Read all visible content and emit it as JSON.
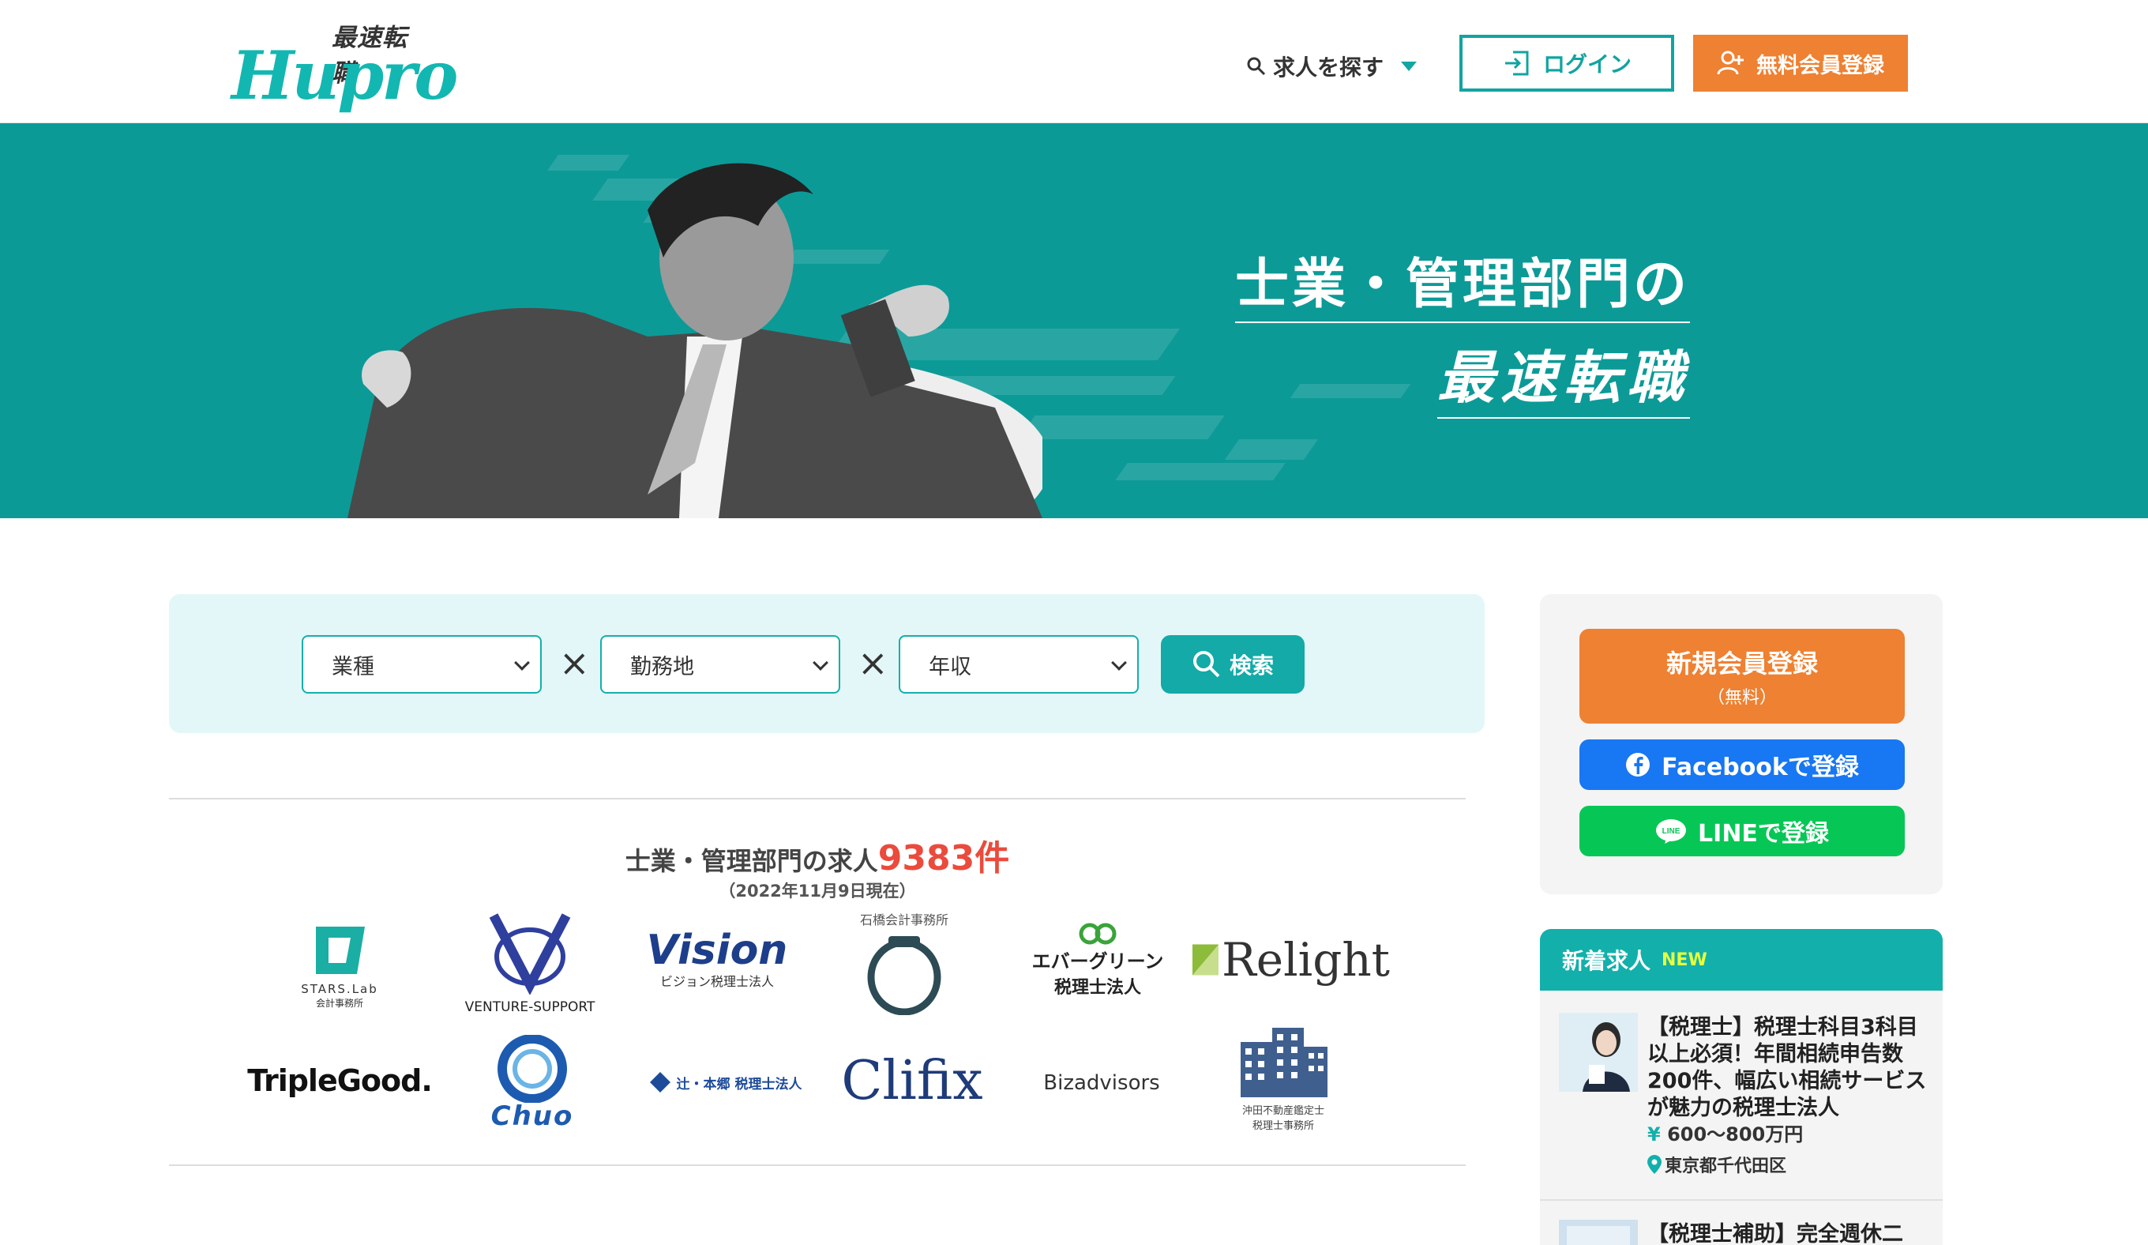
{
  "header": {
    "logo_tagline": "最速転職",
    "logo_word": "Hupro",
    "nav_search_label": "求人を探す",
    "login_label": "ログイン",
    "register_label": "無料会員登録"
  },
  "hero": {
    "line1": "士業・管理部門の",
    "line2": "最速転職"
  },
  "search": {
    "industry_select": "業種",
    "location_select": "勤務地",
    "salary_select": "年収",
    "times_symbol": "×",
    "search_button": "検索"
  },
  "stats": {
    "prefix": "士業・管理部門の求人",
    "count": "9383件",
    "as_of": "（2022年11月9日現在）"
  },
  "company_logos": {
    "stars_lab": "STARS.Lab",
    "stars_lab_sub": "会計事務所",
    "venture_support": "VENTURE-SUPPORT",
    "vision": "Vision",
    "vision_sub": "ビジョン税理士法人",
    "ishibashi": "石橋会計事務所",
    "evergreen": "エバーグリーン",
    "evergreen_sub": "税理士法人",
    "relight": "Relight",
    "triplegood": "TripleGood.",
    "chuo": "Chuo",
    "tsuji_hongo": "辻・本郷 税理士法人",
    "clifix": "Clifix",
    "bizadvisors": "Bizadvisors",
    "okita": "沖田不動産鑑定士",
    "okita_sub": "税理士事務所"
  },
  "sidebar": {
    "new_register": "新規会員登録",
    "new_register_sub": "（無料）",
    "facebook": "Facebookで登録",
    "line": "LINEで登録",
    "new_jobs_title": "新着求人",
    "new_badge": "NEW",
    "jobs": [
      {
        "title": "【税理士】税理士科目3科目以上必須！年間相続申告数200件、幅広い相続サービスが魅力の税理士法人",
        "salary": "600〜800万円",
        "location": "東京都千代田区"
      },
      {
        "title": "【税理士補助】完全週休二",
        "salary": "",
        "location": ""
      }
    ]
  },
  "colors": {
    "teal": "#0c9a97",
    "accent": "#13b0ab",
    "orange": "#ee8132",
    "facebook": "#1877f2",
    "line": "#06c755",
    "count_red": "#ea4b3c"
  }
}
